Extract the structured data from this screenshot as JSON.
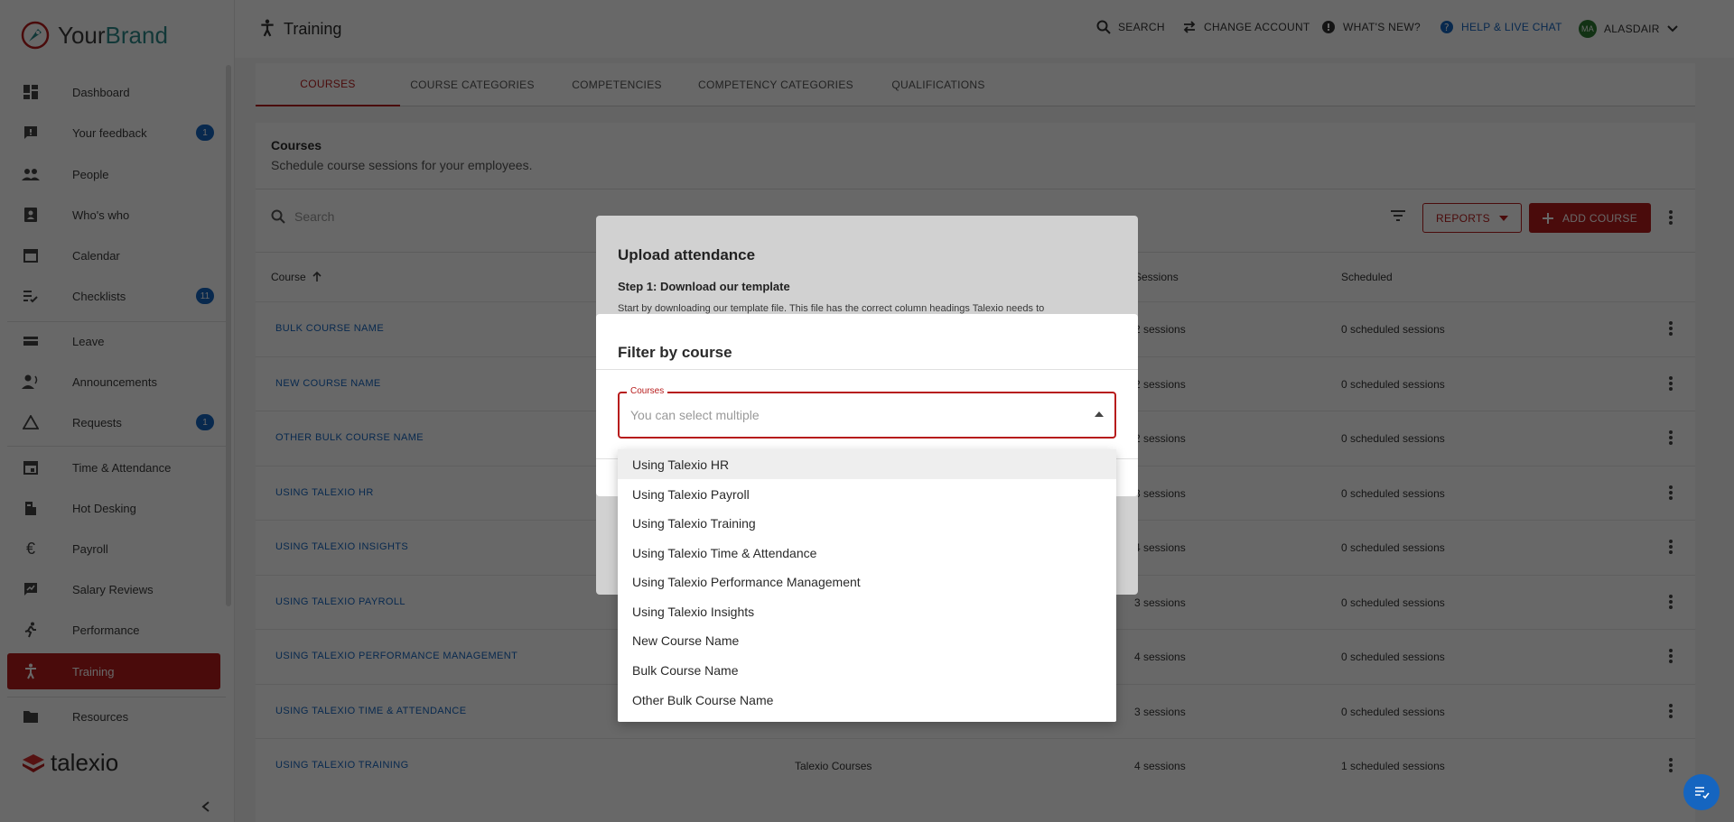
{
  "brand": {
    "name_part1": "Your",
    "name_part2": "Brand",
    "footer_logo": "talexio"
  },
  "sidebar": {
    "items": [
      {
        "label": "Dashboard",
        "icon": "dashboard-icon",
        "badge": ""
      },
      {
        "label": "Your feedback",
        "icon": "feedback-icon",
        "badge": "1"
      },
      {
        "label": "People",
        "icon": "people-icon",
        "badge": ""
      },
      {
        "label": "Who's who",
        "icon": "contact-card-icon",
        "badge": ""
      },
      {
        "label": "Calendar",
        "icon": "calendar-icon",
        "badge": ""
      },
      {
        "label": "Checklists",
        "icon": "checklist-icon",
        "badge": "11"
      },
      {
        "label": "Leave",
        "icon": "leave-icon",
        "badge": ""
      },
      {
        "label": "Announcements",
        "icon": "announcement-icon",
        "badge": ""
      },
      {
        "label": "Requests",
        "icon": "warning-triangle-icon",
        "badge": "1"
      },
      {
        "label": "Time & Attendance",
        "icon": "calendar-today-icon",
        "badge": ""
      },
      {
        "label": "Hot Desking",
        "icon": "desk-icon",
        "badge": ""
      },
      {
        "label": "Payroll",
        "icon": "euro-icon",
        "badge": ""
      },
      {
        "label": "Salary Reviews",
        "icon": "rate-review-icon",
        "badge": ""
      },
      {
        "label": "Performance",
        "icon": "running-icon",
        "badge": ""
      },
      {
        "label": "Training",
        "icon": "accessibility-icon",
        "badge": ""
      },
      {
        "label": "Resources",
        "icon": "folder-icon",
        "badge": ""
      }
    ]
  },
  "header": {
    "title": "Training",
    "search": "SEARCH",
    "change_account": "CHANGE ACCOUNT",
    "whats_new": "WHAT'S NEW?",
    "help": "HELP & LIVE CHAT",
    "avatar_initials": "MA",
    "user": "ALASDAIR"
  },
  "tabs": [
    "COURSES",
    "COURSE CATEGORIES",
    "COMPETENCIES",
    "COMPETENCY CATEGORIES",
    "QUALIFICATIONS"
  ],
  "courses_card": {
    "title": "Courses",
    "subtitle": "Schedule course sessions for your employees.",
    "search_placeholder": "Search",
    "reports_label": "REPORTS",
    "add_label": "ADD COURSE",
    "columns": {
      "course": "Course",
      "sessions": "Sessions",
      "scheduled": "Scheduled"
    },
    "rows": [
      {
        "name": "BULK COURSE NAME",
        "category": "",
        "sessions": "2 sessions",
        "scheduled": "0 scheduled sessions"
      },
      {
        "name": "NEW COURSE NAME",
        "category": "",
        "sessions": "2 sessions",
        "scheduled": "0 scheduled sessions"
      },
      {
        "name": "OTHER BULK COURSE NAME",
        "category": "",
        "sessions": "2 sessions",
        "scheduled": "0 scheduled sessions"
      },
      {
        "name": "USING TALEXIO HR",
        "category": "",
        "sessions": "3 sessions",
        "scheduled": "0 scheduled sessions"
      },
      {
        "name": "USING TALEXIO INSIGHTS",
        "category": "",
        "sessions": "4 sessions",
        "scheduled": "0 scheduled sessions"
      },
      {
        "name": "USING TALEXIO PAYROLL",
        "category": "",
        "sessions": "3 sessions",
        "scheduled": "0 scheduled sessions"
      },
      {
        "name": "USING TALEXIO PERFORMANCE MANAGEMENT",
        "category": "",
        "sessions": "4 sessions",
        "scheduled": "0 scheduled sessions"
      },
      {
        "name": "USING TALEXIO TIME & ATTENDANCE",
        "category": "",
        "sessions": "3 sessions",
        "scheduled": "0 scheduled sessions"
      },
      {
        "name": "USING TALEXIO TRAINING",
        "category": "Talexio Courses",
        "sessions": "4 sessions",
        "scheduled": "1 scheduled sessions"
      }
    ]
  },
  "upload_dialog": {
    "title": "Upload attendance",
    "step1": "Step 1: Download our template",
    "step1_text": "Start by downloading our template file. This file has the correct column headings Talexio needs to"
  },
  "filter_dialog": {
    "title": "Filter by course",
    "field_label": "Courses",
    "placeholder": "You can select multiple",
    "options": [
      "Using Talexio HR",
      "Using Talexio Payroll",
      "Using Talexio Training",
      "Using Talexio Time & Attendance",
      "Using Talexio Performance Management",
      "Using Talexio Insights",
      "New Course Name",
      "Bulk Course Name",
      "Other Bulk Course Name"
    ]
  },
  "colors": {
    "accent": "#b71c1c",
    "link": "#1565c0",
    "teal": "#2d8a8a"
  }
}
